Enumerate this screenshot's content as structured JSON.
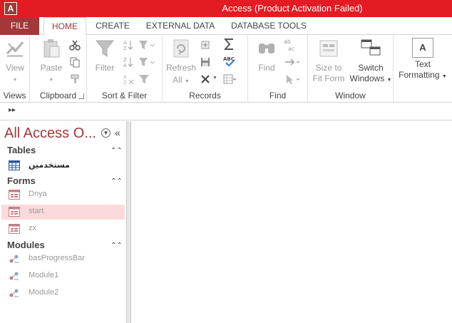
{
  "titlebar": {
    "app_icon": "A",
    "title": "Access (Product Activation Failed)",
    "bg_color": "#e31b23"
  },
  "tabs": {
    "file": "FILE",
    "home": "HOME",
    "create": "CREATE",
    "external": "EXTERNAL DATA",
    "dbtools": "DATABASE TOOLS"
  },
  "ribbon": {
    "views": {
      "group": "Views",
      "view": "View"
    },
    "clipboard": {
      "group": "Clipboard",
      "paste": "Paste"
    },
    "sortfilter": {
      "group": "Sort & Filter",
      "filter": "Filter"
    },
    "records": {
      "group": "Records",
      "refresh": "Refresh",
      "all": "All"
    },
    "find": {
      "group": "Find",
      "find": "Find",
      "replace_icon": "ab/ac"
    },
    "window": {
      "group": "Window",
      "sizefit1": "Size to",
      "sizefit2": "Fit Form",
      "switch1": "Switch",
      "switch2": "Windows"
    },
    "textfmt": {
      "icon": "A",
      "label1": "Text",
      "label2": "Formatting"
    }
  },
  "navpane": {
    "title": "All Access O...",
    "sections": {
      "tables": "Tables",
      "forms": "Forms",
      "modules": "Modules"
    },
    "tables": [
      {
        "name": "مستخدمين"
      }
    ],
    "forms": [
      {
        "name": "Dnya"
      },
      {
        "name": "start"
      },
      {
        "name": "zx"
      }
    ],
    "modules": [
      {
        "name": "basProgressBar"
      },
      {
        "name": "Module1"
      },
      {
        "name": "Module2"
      }
    ]
  },
  "colors": {
    "accent": "#a4373a",
    "selected_item": "#fbdadc"
  }
}
